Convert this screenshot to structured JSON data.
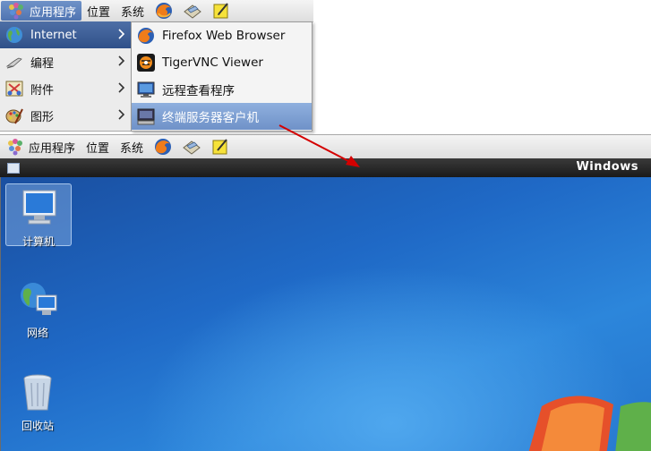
{
  "top_panel": {
    "applications_label": "应用程序",
    "places_label": "位置",
    "system_label": "系统"
  },
  "app_menu": {
    "items": [
      {
        "label": "Internet"
      },
      {
        "label": "编程"
      },
      {
        "label": "附件"
      },
      {
        "label": "图形"
      }
    ]
  },
  "internet_submenu": {
    "items": [
      {
        "label": "Firefox Web Browser"
      },
      {
        "label": "TigerVNC Viewer"
      },
      {
        "label": "远程查看程序"
      },
      {
        "label": "终端服务器客户机"
      }
    ]
  },
  "remote_panel": {
    "applications_label": "应用程序",
    "places_label": "位置",
    "system_label": "系统"
  },
  "window": {
    "title": "Windows"
  },
  "desktop": {
    "icons": [
      {
        "label": "计算机"
      },
      {
        "label": "网络"
      },
      {
        "label": "回收站"
      }
    ]
  },
  "colors": {
    "menu_highlight": "#4e6fa6",
    "submenu_highlight": "#7f9fd2",
    "annotation_arrow": "#d40000",
    "desktop_blue": "#1f69c6"
  }
}
